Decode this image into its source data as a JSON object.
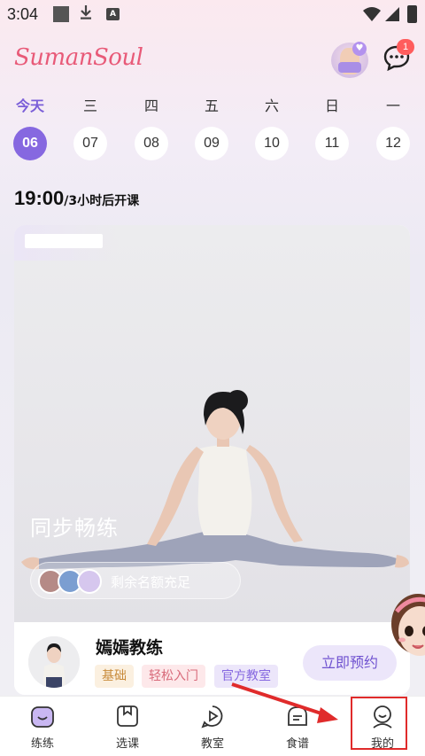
{
  "status_bar": {
    "time": "3:04",
    "a_badge": "A"
  },
  "header": {
    "logo": "SumanSoul",
    "message_count": "1"
  },
  "week": {
    "days": [
      {
        "weekday": "今天",
        "date": "06",
        "active": true
      },
      {
        "weekday": "三",
        "date": "07",
        "active": false
      },
      {
        "weekday": "四",
        "date": "08",
        "active": false
      },
      {
        "weekday": "五",
        "date": "09",
        "active": false
      },
      {
        "weekday": "六",
        "date": "10",
        "active": false
      },
      {
        "weekday": "日",
        "date": "11",
        "active": false
      },
      {
        "weekday": "一",
        "date": "12",
        "active": false
      }
    ]
  },
  "next_class": {
    "time": "19:00",
    "note": "/3小时后开课"
  },
  "class_card": {
    "title": "同步畅练",
    "quota_text": "剩余名额充足",
    "coach_name": "嫣嫣教练",
    "tags": [
      "基础",
      "轻松入门",
      "官方教室"
    ],
    "book_button": "立即预约"
  },
  "bottom_nav": {
    "items": [
      {
        "label": "练练",
        "icon": "practice-icon",
        "active": true
      },
      {
        "label": "选课",
        "icon": "course-select-icon",
        "active": false
      },
      {
        "label": "教室",
        "icon": "classroom-play-icon",
        "active": false
      },
      {
        "label": "食谱",
        "icon": "recipe-icon",
        "active": false
      },
      {
        "label": "我的",
        "icon": "profile-icon",
        "active": false
      }
    ]
  },
  "colors": {
    "brand": "#e85a78",
    "accent": "#8668e0",
    "annotation": "#e02b2b"
  }
}
